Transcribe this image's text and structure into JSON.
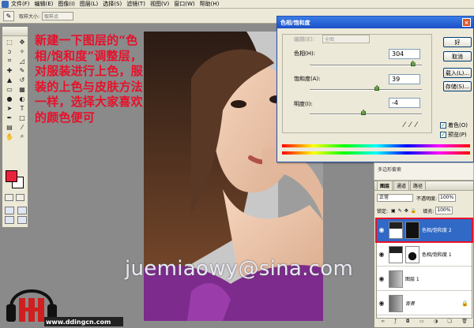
{
  "menubar": {
    "items": [
      "文件(F)",
      "编辑(E)",
      "图像(I)",
      "图层(L)",
      "选择(S)",
      "滤镜(T)",
      "视图(V)",
      "窗口(W)",
      "帮助(H)"
    ]
  },
  "options_bar": {
    "sample_label": "取样大小:",
    "sample_value": "取样点"
  },
  "tutorial": {
    "text": "新建一下图层的“色相/饱和度”调整层，对服装进行上色，服装的上色与皮肤方法一样，选择大家喜欢的颜色便可"
  },
  "watermark": "juemiaowy@sina.com",
  "logo": {
    "url": "www.ddingcn.com"
  },
  "dialog": {
    "title": "色相/饱和度",
    "edit_label": "编辑(E):",
    "edit_value": "全图",
    "hue_label": "色相(H):",
    "hue_value": "304",
    "hue_fraction": 0.92,
    "saturation_label": "饱和度(A):",
    "saturation_value": "39",
    "saturation_fraction": 0.6,
    "lightness_label": "明度(I):",
    "lightness_value": "-4",
    "lightness_fraction": 0.48,
    "buttons": {
      "ok": "好",
      "cancel": "取消",
      "load": "载入(L)...",
      "save": "存储(S)..."
    },
    "colorize_label": "着色(O)",
    "colorize_checked": true,
    "preview_label": "预览(P)",
    "preview_checked": true
  },
  "history": {
    "item": "多边形套索"
  },
  "layers_panel": {
    "tabs": [
      "图层",
      "通道",
      "路径"
    ],
    "blend_mode": "正常",
    "opacity_label": "不透明度:",
    "opacity_value": "100%",
    "lock_label": "锁定:",
    "fill_label": "填充:",
    "fill_value": "100%",
    "layers": [
      {
        "name": "色相/饱和度 2",
        "active": true,
        "has_mask": true
      },
      {
        "name": "色相/饱和度 1",
        "active": false,
        "has_mask": true
      },
      {
        "name": "图层 1",
        "active": false,
        "has_mask": false
      },
      {
        "name": "背景",
        "active": false,
        "has_mask": false,
        "locked": true
      }
    ]
  },
  "colors": {
    "foreground": "#e8233c",
    "background": "#ffffff",
    "tutorial_text": "#e8102a",
    "selection": "#3169c6"
  }
}
